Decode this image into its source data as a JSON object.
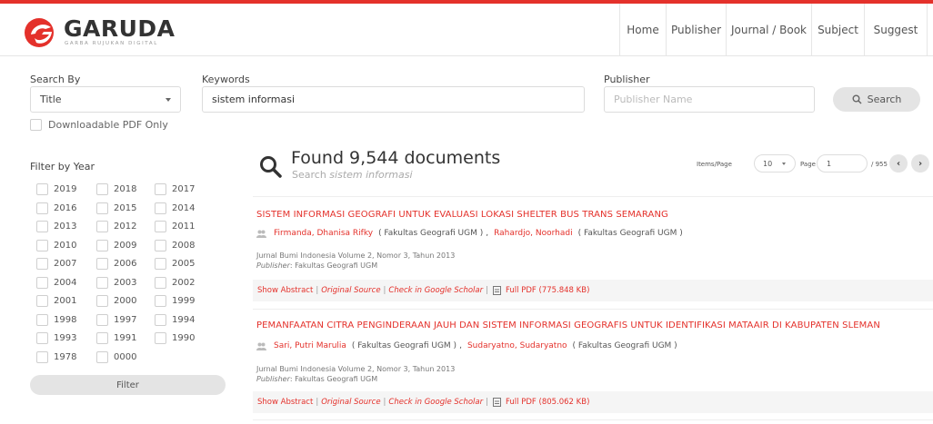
{
  "brand": {
    "name": "GARUDA",
    "tagline": "GARBA RUJUKAN DIGITAL",
    "accent": "#e4312b"
  },
  "nav": {
    "items": [
      "Home",
      "Publisher",
      "Journal / Book",
      "Subject",
      "Suggest"
    ]
  },
  "search": {
    "search_by_label": "Search By",
    "search_by_value": "Title",
    "keywords_label": "Keywords",
    "keywords_value": "sistem informasi",
    "publisher_label": "Publisher",
    "publisher_placeholder": "Publisher Name",
    "button_label": "Search",
    "button_icon": "search-icon",
    "pdf_only_label": "Downloadable PDF Only"
  },
  "filter": {
    "title": "Filter by Year",
    "years": [
      "2019",
      "2018",
      "2017",
      "2016",
      "2015",
      "2014",
      "2013",
      "2012",
      "2011",
      "2010",
      "2009",
      "2008",
      "2007",
      "2006",
      "2005",
      "2004",
      "2003",
      "2002",
      "2001",
      "2000",
      "1999",
      "1998",
      "1997",
      "1994",
      "1993",
      "1991",
      "1990",
      "1978",
      "0000"
    ],
    "button_label": "Filter"
  },
  "results_header": {
    "found_text": "Found 9,544 documents",
    "search_prefix": "Search",
    "search_query": "sistem informasi",
    "items_per_page_label": "Items/Page",
    "items_per_page_value": "10",
    "page_label": "Page",
    "page_value": "1",
    "total_pages": "/ 955",
    "prev_icon": "chevron-left-icon",
    "next_icon": "chevron-right-icon"
  },
  "results": [
    {
      "title": "SISTEM INFORMASI GEOGRAFI UNTUK EVALUASI LOKASI SHELTER BUS TRANS SEMARANG",
      "author1": "Firmanda, Dhanisa Rifky",
      "affil1": "( Fakultas Geografi UGM )",
      "author2": "Rahardjo, Noorhadi",
      "affil2": "( Fakultas Geografi UGM )",
      "journal": "Jurnal Bumi Indonesia Volume 2, Nomor 3, Tahun 2013",
      "publisher_label": "Publisher",
      "publisher": ": Fakultas Geografi UGM",
      "show_abstract": "Show Abstract",
      "original_source": "Original Source",
      "google_scholar": "Check in Google Scholar",
      "full_pdf": "Full PDF (775.848 KB)"
    },
    {
      "title": "PEMANFAATAN CITRA PENGINDERAAN JAUH DAN SISTEM INFORMASI GEOGRAFIS UNTUK IDENTIFIKASI MATAAIR DI KABUPATEN SLEMAN",
      "author1": "Sari, Putri Marulia",
      "affil1": "( Fakultas Geografi UGM )",
      "author2": "Sudaryatno, Sudaryatno",
      "affil2": "( Fakultas Geografi UGM )",
      "journal": "Jurnal Bumi Indonesia Volume 2, Nomor 3, Tahun 2013",
      "publisher_label": "Publisher",
      "publisher": ": Fakultas Geografi UGM",
      "show_abstract": "Show Abstract",
      "original_source": "Original Source",
      "google_scholar": "Check in Google Scholar",
      "full_pdf": "Full PDF (805.062 KB)"
    }
  ]
}
